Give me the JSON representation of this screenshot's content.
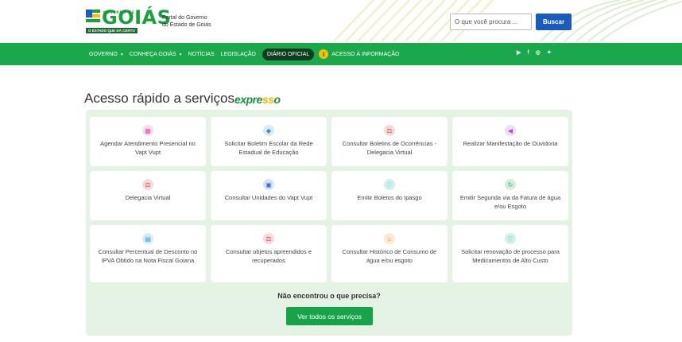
{
  "header": {
    "logo_word": "GOIÁS",
    "logo_top": "GOVERNO DE",
    "logo_tagline": "O ESTADO QUE DÁ CERTO",
    "portal_line1": "Portal do Governo",
    "portal_line2": "do Estado de Goiás",
    "search_placeholder": "O que você procura ...",
    "search_button": "Buscar"
  },
  "nav": {
    "items": [
      {
        "label": "GOVERNO",
        "dropdown": true
      },
      {
        "label": "CONHEÇA GOIÁS",
        "dropdown": true
      },
      {
        "label": "NOTÍCIAS",
        "dropdown": false
      },
      {
        "label": "LEGISLAÇÃO",
        "dropdown": false
      },
      {
        "label": "DIÁRIO OFICIAL",
        "dropdown": false,
        "active": true
      },
      {
        "label": "ACESSO À INFORMAÇÃO",
        "dropdown": false
      }
    ],
    "social": [
      "youtube-icon",
      "facebook-icon",
      "instagram-icon",
      "twitter-icon"
    ],
    "color": "#1aa84a"
  },
  "main": {
    "title": "Acesso rápido a serviços",
    "brand_a": "expre",
    "brand_b": "ss",
    "brand_c": "o",
    "not_found": "Não encontrou o que precisa?",
    "all_services": "Ver todos os serviços"
  },
  "services": [
    {
      "label": "Agendar Atendimento Presencial no Vapt Vupt",
      "icon": "calendar-icon",
      "color": "#e84fa8"
    },
    {
      "label": "Solicitar Boletim Escolar da Rede Estadual de Educação",
      "icon": "graduation-icon",
      "color": "#3a8fd8"
    },
    {
      "label": "Consultar Boletins de Ocorrências - Delegacia Virtual",
      "icon": "scales-icon",
      "color": "#e04848"
    },
    {
      "label": "Realizar Manifestação de Ouvidoria",
      "icon": "megaphone-icon",
      "color": "#b04fd8"
    },
    {
      "label": "Delegacia Virtual",
      "icon": "scales-icon",
      "color": "#e04848"
    },
    {
      "label": "Consultar Unidades do Vapt Vupt",
      "icon": "briefcase-icon",
      "color": "#3a6fd8"
    },
    {
      "label": "Emitir Boletos do Ipasgo",
      "icon": "heart-icon",
      "color": "#1fb39a"
    },
    {
      "label": "Emitir Segunda via da Fatura de água e/ou Esgoto",
      "icon": "recycle-icon",
      "color": "#2ea84a"
    },
    {
      "label": "Consultar Percentual de Desconto no IPVA Obtido na Nota Fiscal Goiana",
      "icon": "receipt-icon",
      "color": "#2a9fd8"
    },
    {
      "label": "Consultar objetos apreendidos e recuperados",
      "icon": "scales-icon",
      "color": "#e04848"
    },
    {
      "label": "Consultar Histórico de Consumo de água e/ou esgoto",
      "icon": "home-icon",
      "color": "#f08a2a"
    },
    {
      "label": "Solicitar renovação de processo para Medicamentos de Alto Custo",
      "icon": "heart-icon",
      "color": "#1fb39a"
    }
  ]
}
